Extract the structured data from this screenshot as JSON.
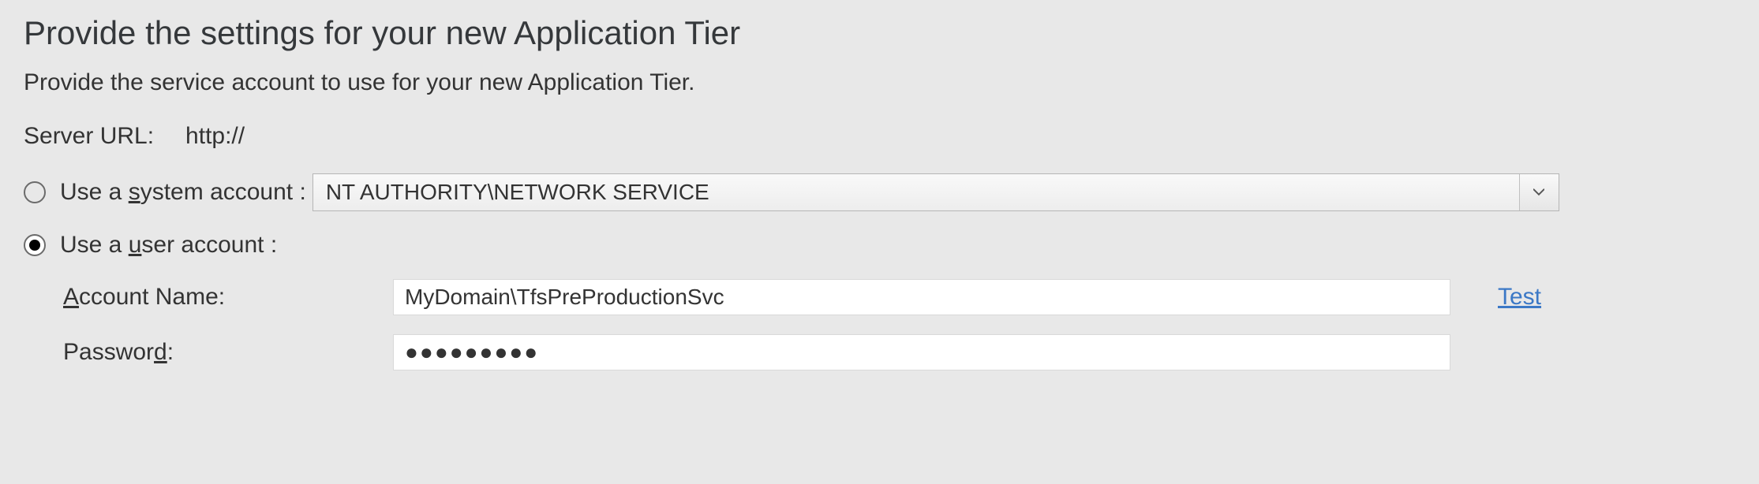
{
  "page": {
    "title": "Provide the settings for your new Application Tier",
    "description": "Provide the service account to use for your new Application Tier."
  },
  "server": {
    "label": "Server URL:",
    "value": "http://"
  },
  "account": {
    "system": {
      "label_pre": "Use a ",
      "label_ul": "s",
      "label_post": "ystem account :",
      "selected_option": "NT AUTHORITY\\NETWORK SERVICE"
    },
    "user": {
      "label_pre": "Use a ",
      "label_ul": "u",
      "label_post": "ser account :"
    },
    "name": {
      "label_ul": "A",
      "label_post": "ccount Name:",
      "value": "MyDomain\\TfsPreProductionSvc"
    },
    "password": {
      "label_pre": "Passwor",
      "label_ul": "d",
      "label_post": ":",
      "value": "●●●●●●●●●"
    },
    "test_label": "Test"
  }
}
